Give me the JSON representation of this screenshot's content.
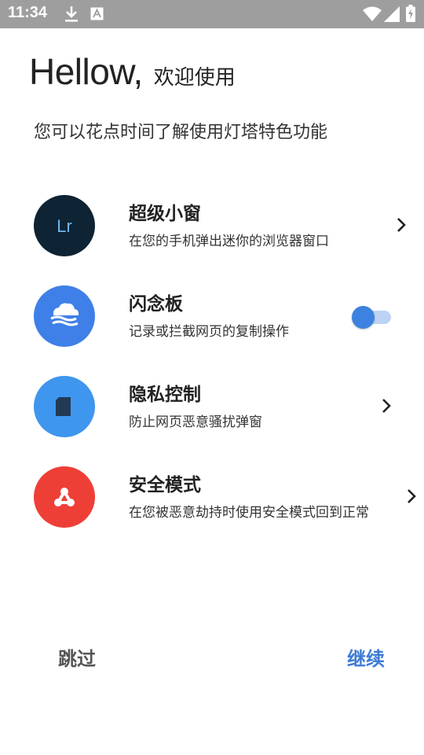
{
  "status_bar": {
    "time": "11:34",
    "icons": [
      "download-icon",
      "a-notification-icon",
      "wifi-icon",
      "signal-icon",
      "battery-charging-icon"
    ]
  },
  "header": {
    "hello": "Hellow,",
    "welcome": "欢迎使用",
    "subtitle": "您可以花点时间了解使用灯塔特色功能"
  },
  "features": [
    {
      "title": "超级小窗",
      "description": "在您的手机弹出迷你的浏览器窗口",
      "icon_text": "Lr",
      "icon": "lr-app-icon",
      "icon_color": "#0e2333",
      "control": "chevron"
    },
    {
      "title": "闪念板",
      "description": "记录或拦截网页的复制操作",
      "icon": "cloud-wave-icon",
      "icon_color": "#3f7fe8",
      "control": "toggle",
      "toggle_on": true
    },
    {
      "title": "隐私控制",
      "description": "防止网页恶意骚扰弹窗",
      "icon": "sd-card-icon",
      "icon_color": "#3f96ee",
      "control": "chevron"
    },
    {
      "title": "安全模式",
      "description": "在您被恶意劫持时使用安全模式回到正常",
      "icon": "triad-shield-icon",
      "icon_color": "#ee3f37",
      "control": "chevron"
    }
  ],
  "footer": {
    "skip_label": "跳过",
    "continue_label": "继续"
  },
  "colors": {
    "status_bar": "#9e9e9e",
    "accent": "#3d7bd6",
    "toggle_track": "#bcd3f5"
  }
}
